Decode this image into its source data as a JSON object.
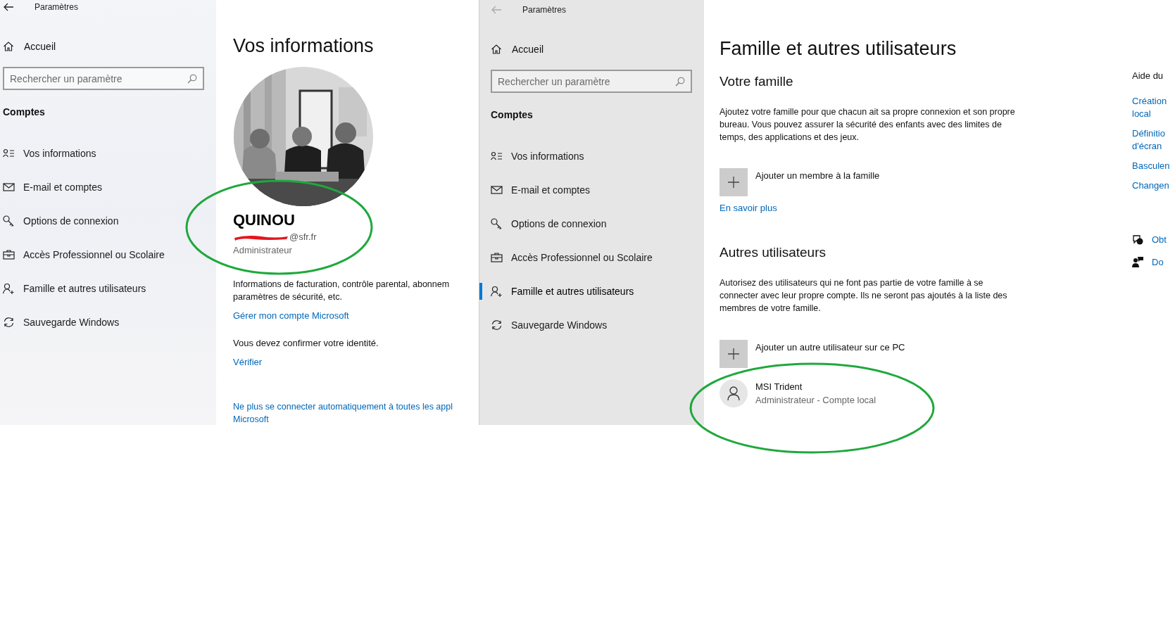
{
  "windows": [
    {
      "title": "Paramètres",
      "back_disabled": false,
      "home": "Accueil",
      "search": {
        "placeholder": "Rechercher un paramètre"
      },
      "section": "Comptes",
      "nav": [
        {
          "label": "Vos informations",
          "selected": false
        },
        {
          "label": "E-mail et comptes",
          "selected": false
        },
        {
          "label": "Options de connexion",
          "selected": false
        },
        {
          "label": "Accès Professionnel ou Scolaire",
          "selected": false
        },
        {
          "label": "Famille et autres utilisateurs",
          "selected": false
        },
        {
          "label": "Sauvegarde Windows",
          "selected": false
        }
      ],
      "content": {
        "kind": "profile",
        "title": "Vos informations",
        "name": "QUINOU",
        "email": "@sfr.fr",
        "email_redacted": true,
        "role": "Administrateur",
        "circled": true,
        "billing_lines": [
          "Informations de facturation, contrôle parental, abonnem",
          "paramètres de sécurité, etc."
        ],
        "manage_link": "Gérer mon compte Microsoft",
        "identity_text": "Vous devez confirmer votre identité.",
        "verify_link": "Vérifier",
        "auto_link_lines": [
          "Ne plus se connecter automatiquement à toutes les appl",
          "Microsoft"
        ]
      }
    },
    {
      "title": "Paramètres",
      "back_disabled": true,
      "home": "Accueil",
      "search": {
        "placeholder": "Rechercher un paramètre"
      },
      "section": "Comptes",
      "nav": [
        {
          "label": "Vos informations",
          "selected": false
        },
        {
          "label": "E-mail et comptes",
          "selected": false
        },
        {
          "label": "Options de connexion",
          "selected": false
        },
        {
          "label": "Accès Professionnel ou Scolaire",
          "selected": false
        },
        {
          "label": "Famille et autres utilisateurs",
          "selected": true
        },
        {
          "label": "Sauvegarde Windows",
          "selected": false
        }
      ],
      "content": {
        "kind": "family",
        "title": "Famille et autres utilisateurs",
        "family": {
          "heading": "Votre famille",
          "text": "Ajoutez votre famille pour que chacun ait sa propre connexion et son propre bureau. Vous pouvez assurer la sécurité des enfants avec des limites de temps, des applications et des jeux.",
          "add_label": "Ajouter un membre à la famille",
          "learn_more": "En savoir plus"
        },
        "others": {
          "heading": "Autres utilisateurs",
          "text": "Autorisez des utilisateurs qui ne font pas partie de votre famille à se connecter avec leur propre compte. Ils ne seront pas ajoutés à la liste des membres de votre famille.",
          "add_label": "Ajouter un autre utilisateur sur ce PC",
          "users": [
            {
              "name": "MSI Trident",
              "detail": "Administrateur - Compte local",
              "circled": true
            }
          ]
        },
        "help": {
          "heading": "Aide du",
          "links": [
            [
              "Création",
              "local"
            ],
            [
              "Définitio",
              "d'écran"
            ],
            [
              "Basculen"
            ],
            [
              "Changen"
            ]
          ],
          "actions": [
            "Obt",
            "Do"
          ]
        }
      }
    }
  ]
}
